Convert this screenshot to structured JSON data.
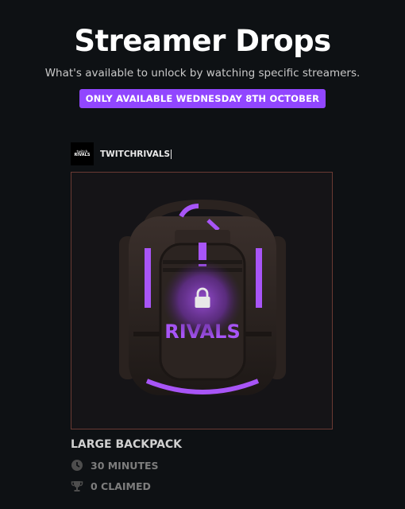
{
  "header": {
    "title": "Streamer Drops",
    "subtitle": "What's available to unlock by watching specific streamers.",
    "badge": "ONLY AVAILABLE WEDNESDAY 8TH OCTOBER"
  },
  "streamer": {
    "logo_line1": "twitch",
    "logo_line2": "RIVALS",
    "name": "TWITCHRIVALS"
  },
  "drop": {
    "item_name": "LARGE BACKPACK",
    "image_text": "RIVALS",
    "duration": "30 MINUTES",
    "claimed": "0 CLAIMED",
    "locked": true
  },
  "colors": {
    "accent": "#9146ff",
    "background": "#0e1114",
    "card_border": "#6a3a33"
  },
  "icons": {
    "lock": "lock-icon",
    "clock": "clock-icon",
    "trophy": "trophy-icon"
  }
}
